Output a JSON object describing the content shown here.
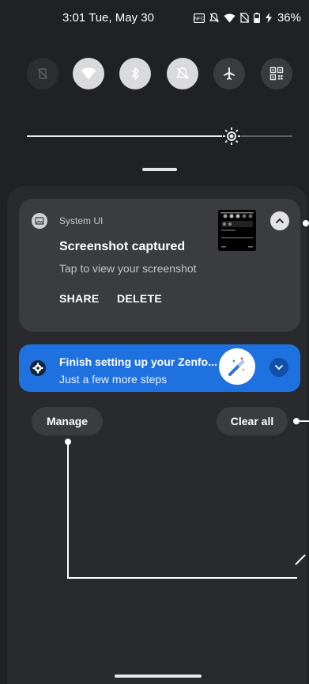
{
  "status_bar": {
    "time": "3:01",
    "date": "Tue, May 30",
    "battery_percent": "36%",
    "icons": [
      "nfc-icon",
      "dnd-off-icon",
      "wifi-icon",
      "no-sim-icon",
      "battery-icon",
      "charging-icon"
    ]
  },
  "quick_tiles": [
    {
      "name": "auto-rotate-tile",
      "icon": "rotation-lock-icon",
      "state": "off"
    },
    {
      "name": "wifi-tile",
      "icon": "wifi-icon",
      "state": "on"
    },
    {
      "name": "bluetooth-tile",
      "icon": "bluetooth-icon",
      "state": "on"
    },
    {
      "name": "mute-tile",
      "icon": "bell-off-icon",
      "state": "on"
    },
    {
      "name": "airplane-mode-tile",
      "icon": "airplane-icon",
      "state": "dim"
    },
    {
      "name": "qr-scanner-tile",
      "icon": "qr-code-icon",
      "state": "dim"
    }
  ],
  "brightness": {
    "level": 0.77
  },
  "notifications": {
    "screenshot": {
      "app_name": "System UI",
      "title": "Screenshot captured",
      "text": "Tap to view your screenshot",
      "actions": [
        "SHARE",
        "DELETE"
      ]
    },
    "setup": {
      "title": "Finish setting up your Zenfo...",
      "text": "Just a few more steps"
    }
  },
  "buttons": {
    "manage": "Manage",
    "clear_all": "Clear all"
  },
  "colors": {
    "background": "#202124",
    "panel": "#292a2e",
    "card": "#3b3c40",
    "setup_card": "#1f71e0"
  }
}
